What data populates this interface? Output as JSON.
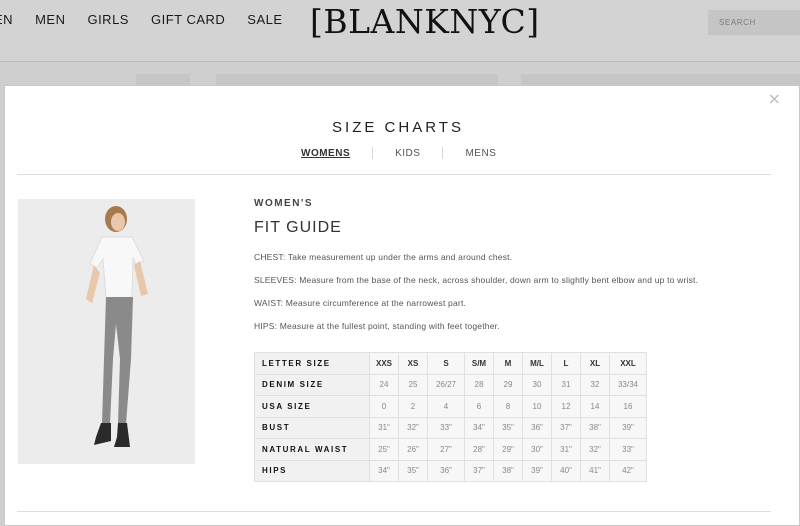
{
  "background": {
    "nav": [
      "EN",
      "MEN",
      "GIRLS",
      "GIFT CARD",
      "SALE"
    ],
    "logo": "[BLANKNYC]",
    "search_placeholder": "SEARCH"
  },
  "modal": {
    "close_symbol": "×",
    "title": "SIZE CHARTS",
    "tabs": [
      "WOMENS",
      "KIDS",
      "MENS"
    ],
    "active_tab": "WOMENS",
    "category": "WOMEN'S",
    "guide_title": "FIT GUIDE",
    "descriptions": [
      "CHEST: Take measurement up under the arms and around chest.",
      "SLEEVES: Measure from the base of the neck, across shoulder, down arm to slightly bent elbow and up to wrist.",
      "WAIST: Measure circumference at the narrowest part.",
      "HIPS: Measure at the fullest point, standing with feet together."
    ],
    "table": {
      "rows": [
        {
          "label": "LETTER SIZE",
          "values": [
            "XXS",
            "XS",
            "S",
            "S/M",
            "M",
            "M/L",
            "L",
            "XL",
            "XXL"
          ]
        },
        {
          "label": "DENIM SIZE",
          "values": [
            "24",
            "25",
            "26/27",
            "28",
            "29",
            "30",
            "31",
            "32",
            "33/34"
          ]
        },
        {
          "label": "USA SIZE",
          "values": [
            "0",
            "2",
            "4",
            "6",
            "8",
            "10",
            "12",
            "14",
            "16"
          ]
        },
        {
          "label": "BUST",
          "values": [
            "31\"",
            "32\"",
            "33\"",
            "34\"",
            "35\"",
            "36\"",
            "37\"",
            "38\"",
            "39\""
          ]
        },
        {
          "label": "NATURAL WAIST",
          "values": [
            "25\"",
            "26\"",
            "27\"",
            "28\"",
            "29\"",
            "30\"",
            "31\"",
            "32\"",
            "33\""
          ]
        },
        {
          "label": "HIPS",
          "values": [
            "34\"",
            "35\"",
            "36\"",
            "37\"",
            "38\"",
            "39\"",
            "40\"",
            "41\"",
            "42\""
          ]
        }
      ]
    }
  }
}
